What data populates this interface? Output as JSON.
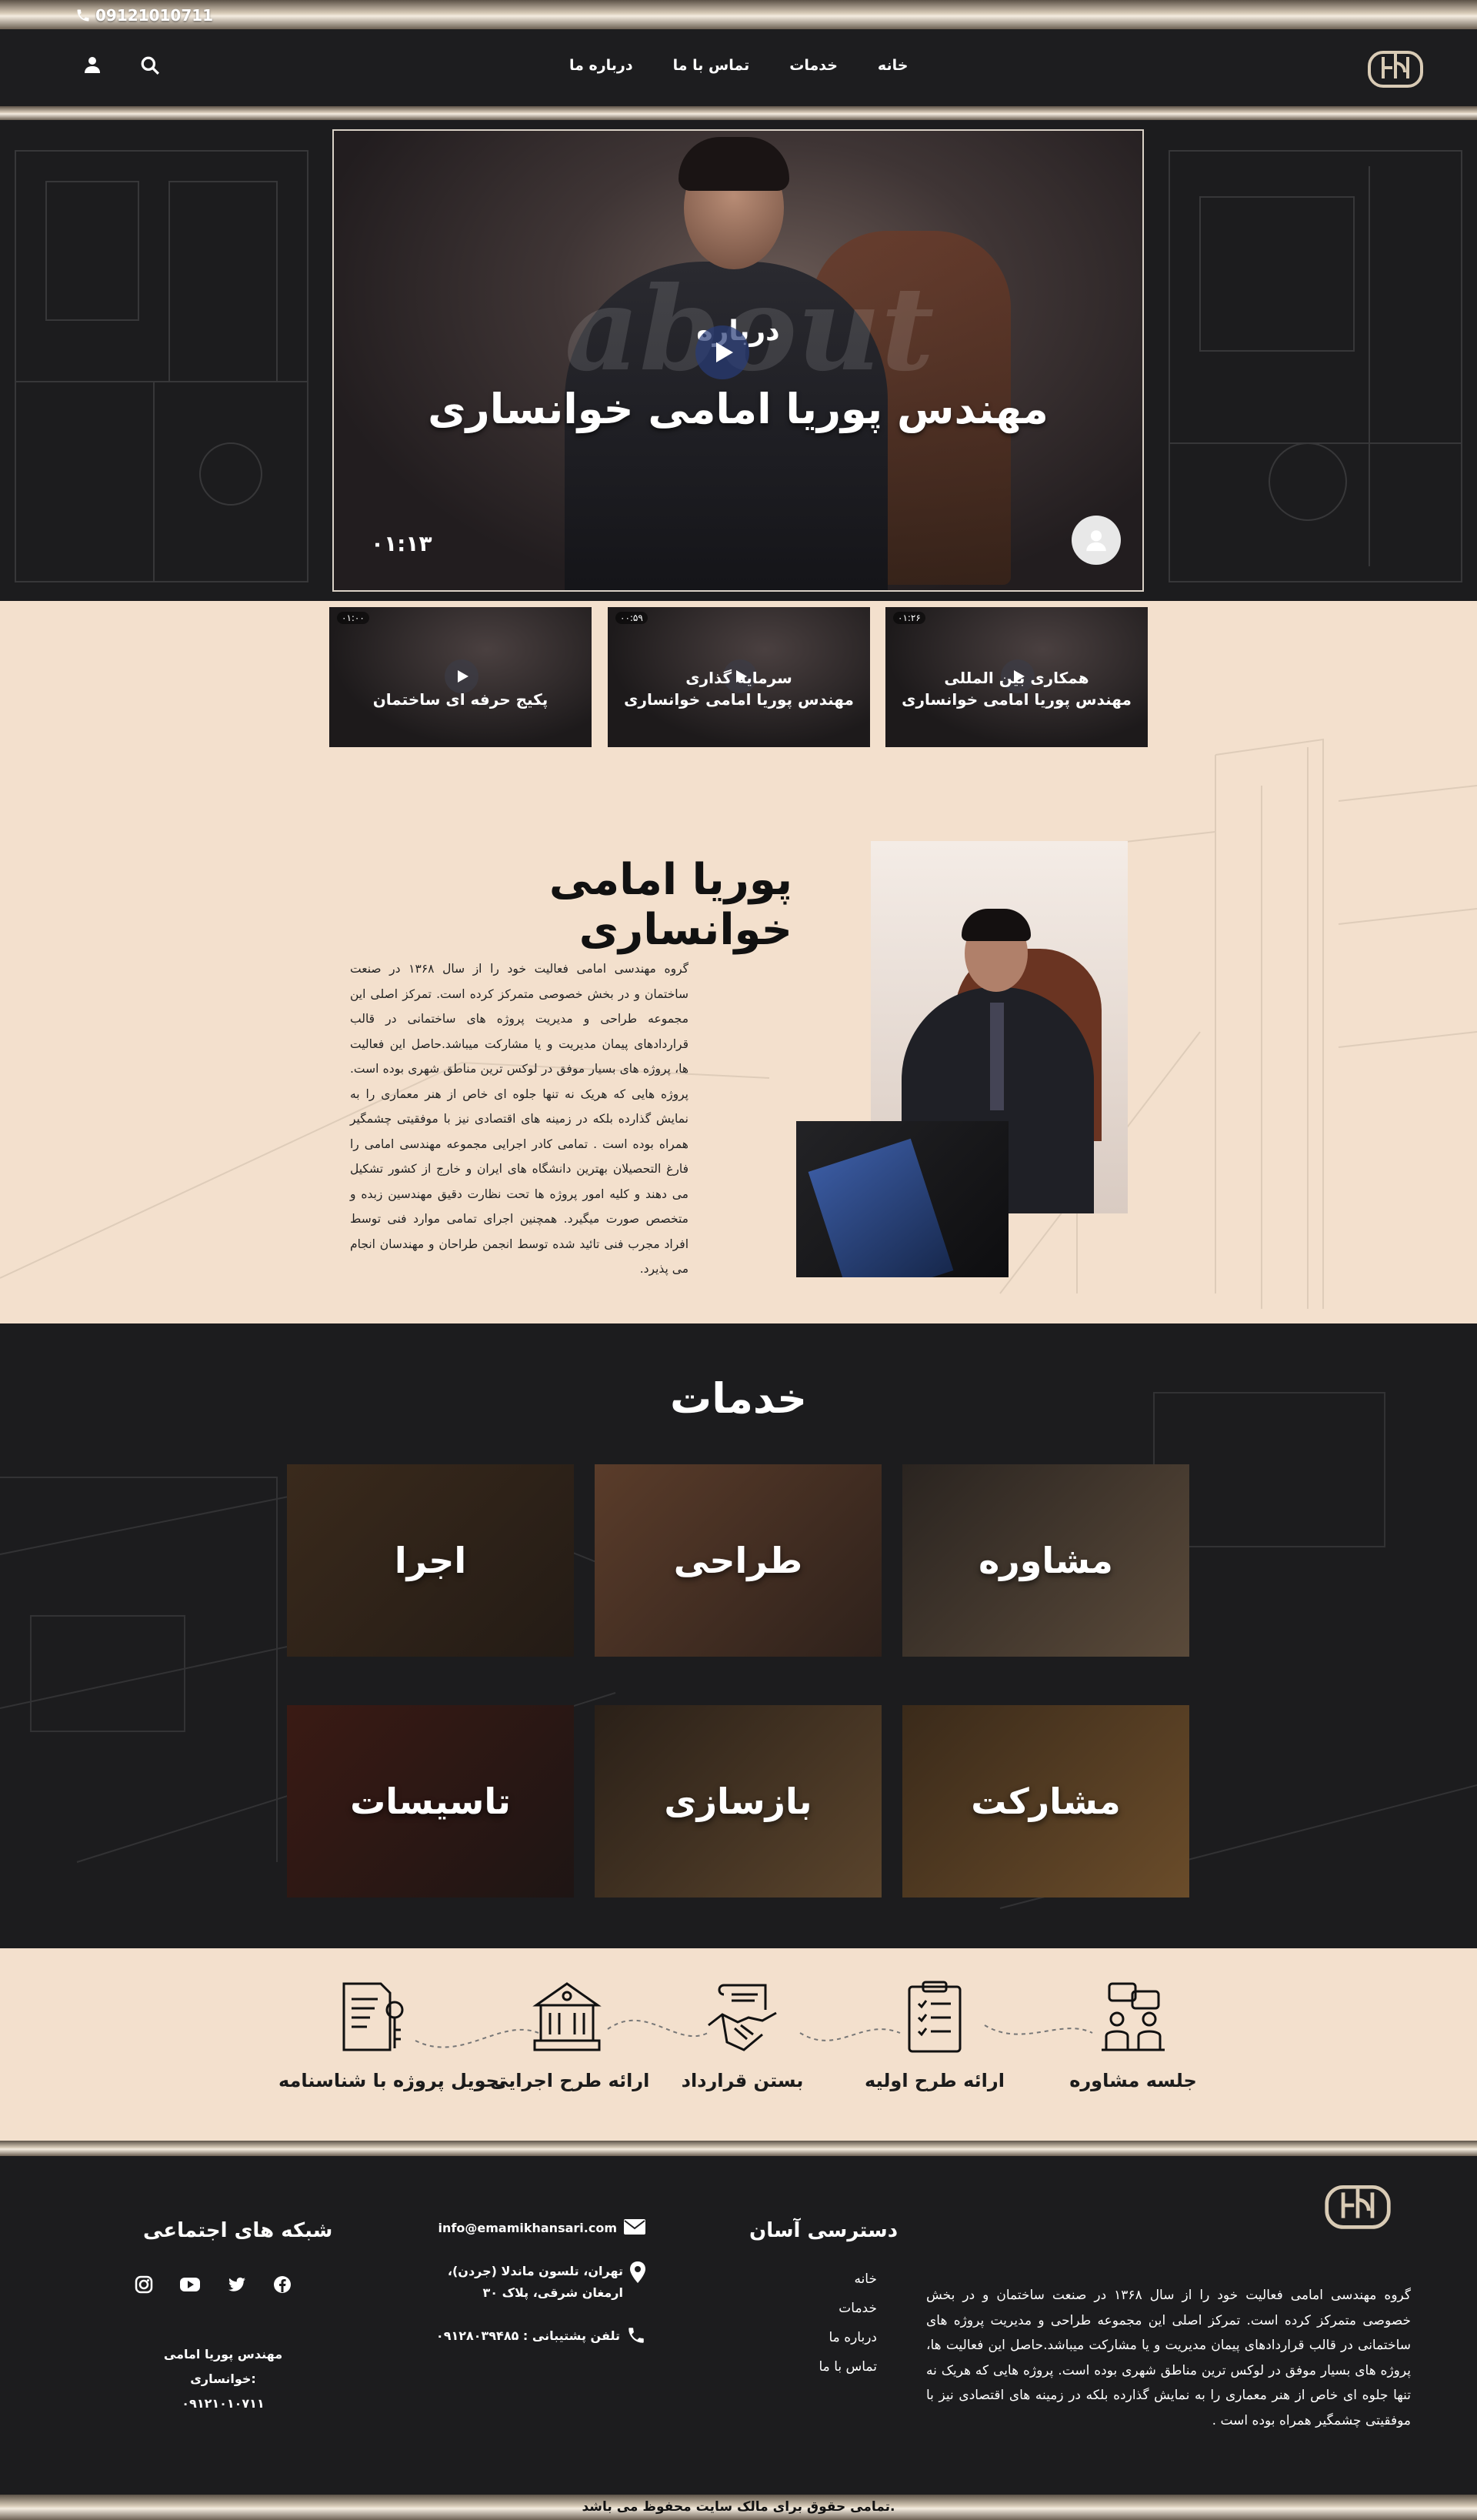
{
  "topbar": {
    "phone": "09121010711"
  },
  "nav": {
    "items": [
      "خانه",
      "خدمات",
      "تماس با ما",
      "درباره ما"
    ]
  },
  "hero": {
    "ghost_word": "about",
    "small_title": "درباره",
    "title": "مهندس پوریا امامی خوانساری",
    "duration": "۰۱:۱۳"
  },
  "thumbnails": [
    {
      "badge": "۰۱:۲۶",
      "line1": "همکاری بین المللی",
      "line2": "مهندس پوریا امامی خوانساری"
    },
    {
      "badge": "۰۰:۵۹",
      "line1": "سرمایه گذاری",
      "line2": "مهندس پوریا امامی خوانساری"
    },
    {
      "badge": "۰۱:۰۰",
      "line1": "",
      "line2": "پکیج حرفه ای ساختمان"
    }
  ],
  "about": {
    "title": "پوریا امامی خوانساری",
    "text": "گروه مهندسی امامی فعالیت خود را از سال ۱۳۶۸ در صنعت ساختمان و در بخش خصوصی متمرکز کرده است. تمرکز اصلی این مجموعه طراحی و مدیریت پروژه های ساختمانی در قالب قراردادهای پیمان مدیریت و یا مشارکت میباشد.حاصل این فعالیت ها، پروژه های بسیار موفق در لوکس ترین مناطق شهری بوده است. پروژه هایی که هریک نه تنها جلوه ای خاص از هنر معماری را به نمایش گذارده بلکه در زمینه های اقتصادی نیز با موفقیتی چشمگیر همراه بوده است . تمامی کادر اجرایی مجموعه مهندسی امامی را فارغ التحصیلان بهترین دانشگاه های ایران و خارج از کشور تشکیل می دهند و کلیه امور پروژه ها تحت نظارت دقیق مهندسین زبده و متخصص صورت میگیرد. همچنین اجرای تمامی موارد فنی توسط افراد مجرب فنی تائید شده توسط انجمن طراحان و مهندسان انجام می پذیرد."
  },
  "services": {
    "title": "خدمات",
    "items": [
      "مشاوره",
      "طراحی",
      "اجرا",
      "مشارکت",
      "بازسازی",
      "تاسیسات"
    ]
  },
  "process": {
    "steps": [
      "جلسه مشاوره",
      "ارائه طرح اولیه",
      "بستن قرارداد",
      "ارائه طرح اجرایی",
      "تحویل پروژه با شناسنامه"
    ]
  },
  "footer": {
    "about": "گروه مهندسی امامی فعالیت خود را از سال ۱۳۶۸ در صنعت ساختمان و در بخش خصوصی متمرکز کرده است. تمرکز اصلی این مجموعه طراحی و مدیریت پروژه های ساختمانی در قالب قراردادهای پیمان مدیریت و یا مشارکت میباشد.حاصل این فعالیت ها، پروژه های بسیار موفق در لوکس ترین مناطق شهری بوده است. پروژه هایی که هریک نه تنها جلوه ای خاص از هنر معماری را به نمایش گذارده بلکه در زمینه های اقتصادی نیز با موفقیتی چشمگیر همراه بوده است .",
    "quick_access_title": "دسترسی آسان",
    "quick_links": [
      "خانه",
      "خدمات",
      "درباره ما",
      "تماس با ما"
    ],
    "email": "info@emamikhansari.com",
    "address": "تهران، تلسون ماندلا (جردن)، ارمغان شرقی، پلاک ۳۰",
    "support_phone": "تلفن پشتیبانی : ۰۹۱۲۸۰۳۹۴۸۵",
    "social_title": "شبکه های اجتماعی",
    "signature_name": "مهندس پوریا امامی خوانساری:",
    "signature_phone": "۰۹۱۲۱۰۱۰۷۱۱",
    "copyright": "تمامی حقوق برای مالک سایت محفوظ می باشد."
  },
  "colors": {
    "beige": "#f3e0cd",
    "dark": "#1c1c1e",
    "gold": "#d8cbb8"
  }
}
